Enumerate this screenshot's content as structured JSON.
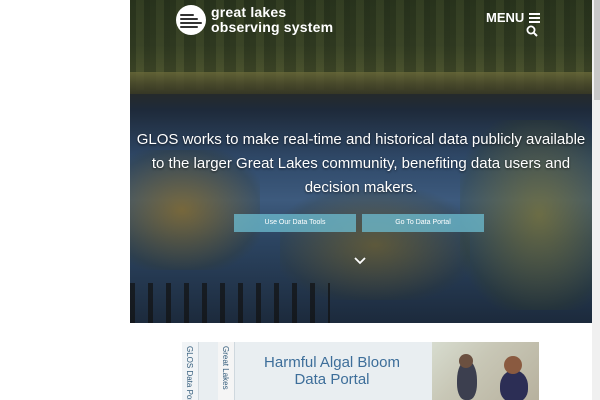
{
  "header": {
    "logo_line1": "great lakes",
    "logo_line2": "observing system",
    "menu_label": "MENU",
    "menu_icon": "hamburger-icon",
    "search_icon": "search-icon"
  },
  "hero": {
    "tagline": "GLOS works to make real-time and historical data publicly available to the larger Great Lakes community, benefiting data users and decision makers.",
    "buttons": [
      {
        "label": "Use Our Data Tools"
      },
      {
        "label": "Go To Data Portal"
      }
    ],
    "scroll_icon": "chevron-down-icon"
  },
  "banner": {
    "side_tabs": [
      "GLOS Data Portal",
      "Great Lakes"
    ],
    "title": "Harmful Algal Bloom Data Portal"
  },
  "colors": {
    "accent_button": "#6ebed2",
    "banner_title": "#3d6e9a",
    "banner_bg": "#e9eef1"
  }
}
